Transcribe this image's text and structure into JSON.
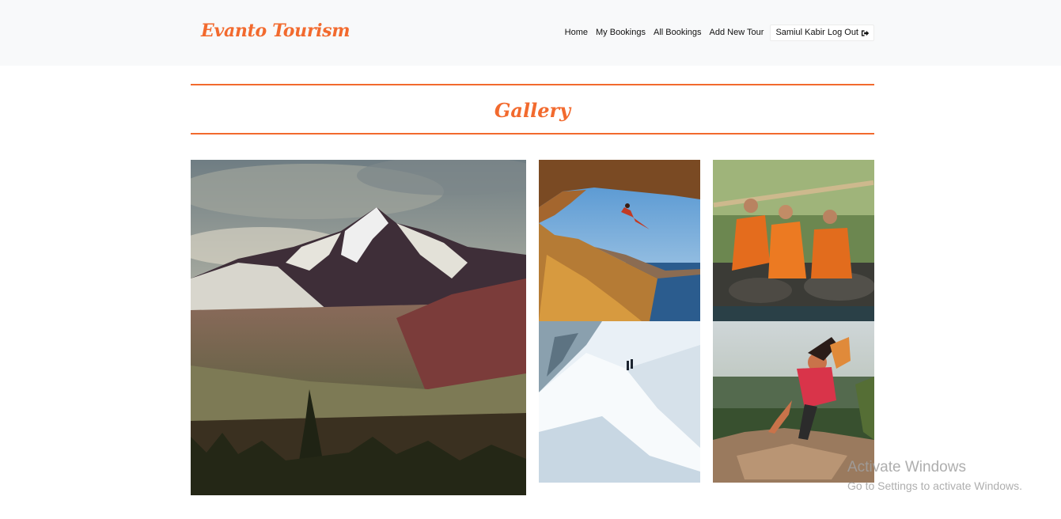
{
  "brand": "Evanto Tourism",
  "nav": {
    "home": "Home",
    "my_bookings": "My Bookings",
    "all_bookings": "All Bookings",
    "add_new_tour": "Add New Tour",
    "user_logout": "Samiul Kabir Log Out"
  },
  "page_title": "Gallery",
  "colors": {
    "accent": "#f26a2e",
    "navbar_bg": "#f8f9fa"
  },
  "gallery": [
    {
      "subject": "snowy mountain peak above pine forest"
    },
    {
      "subject": "climber under rock arch above sea coast"
    },
    {
      "subject": "three monks sitting by stream"
    },
    {
      "subject": "two climbers on snow ridge"
    },
    {
      "subject": "hiker climbing rocky cliff"
    }
  ],
  "watermark": {
    "line1": "Activate Windows",
    "line2": "Go to Settings to activate Windows."
  }
}
